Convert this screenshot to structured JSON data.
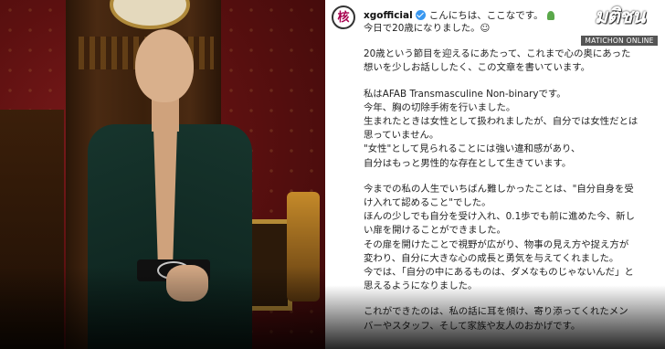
{
  "post": {
    "username": "xgofficial",
    "avatar_glyph": "核",
    "header_text": "こんにちは、ここなです。",
    "lines": [
      "今日で20歳になりました。☺",
      "",
      "20歳という節目を迎えるにあたって、これまで心の奥にあった",
      "想いを少しお話ししたく、この文章を書いています。",
      "",
      "私はAFAB Transmasculine Non-binaryです。",
      "今年、胸の切除手術を行いました。",
      "生まれたときは女性として扱われましたが、自分では女性だとは",
      "思っていません。",
      "\"女性\"として見られることには強い違和感があり、",
      "自分はもっと男性的な存在として生きています。",
      "",
      "今までの私の人生でいちばん難しかったことは、\"自分自身を受",
      "け入れて認めること\"でした。",
      "ほんの少しでも自分を受け入れ、0.1歩でも前に進めた今、新し",
      "い扉を開けることができました。",
      "その扉を開けたことで視野が広がり、物事の見え方や捉え方が",
      "変わり、自分に大きな心の成長と勇気を与えてくれました。",
      "今では、「自分の中にあるものは、ダメなものじゃないんだ」と",
      "思えるようになりました。",
      "",
      "これができたのは、私の話に耳を傾け、寄り添ってくれたメン",
      "バーやスタッフ、そして家族や友人のおかげです。"
    ]
  },
  "watermark": {
    "main": "มติชน",
    "sub": "MATICHON ONLINE"
  },
  "icons": {
    "verified": "verified-badge-icon",
    "plant": "seedling-emoji-icon"
  },
  "colors": {
    "verified_blue": "#3897f0",
    "avatar_accent": "#a8004f",
    "wall_red": "#5c1010",
    "jacket_green": "#17352d"
  }
}
